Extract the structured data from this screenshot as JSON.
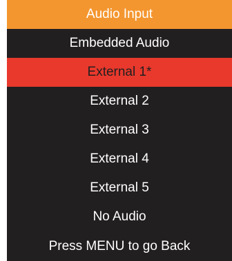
{
  "menu": {
    "title": "Audio Input",
    "items": [
      {
        "label": "Embedded Audio",
        "selected": false
      },
      {
        "label": "External 1*",
        "selected": true
      },
      {
        "label": "External 2",
        "selected": false
      },
      {
        "label": "External 3",
        "selected": false
      },
      {
        "label": "External 4",
        "selected": false
      },
      {
        "label": "External 5",
        "selected": false
      },
      {
        "label": "No Audio",
        "selected": false
      }
    ],
    "footer": "Press MENU to go Back"
  },
  "colors": {
    "title_bar": "#f4962f",
    "background": "#221f20",
    "selected_highlight": "#e8392c",
    "text": "#ffffff",
    "selected_text": "#221f20"
  }
}
